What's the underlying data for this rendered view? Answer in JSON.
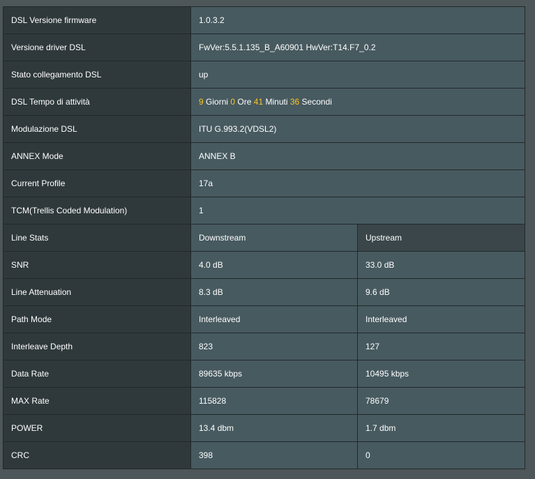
{
  "info_rows": [
    {
      "label": "DSL Versione firmware",
      "value": "1.0.3.2"
    },
    {
      "label": "Versione driver DSL",
      "value": "FwVer:5.5.1.135_B_A60901 HwVer:T14.F7_0.2"
    },
    {
      "label": "Stato collegamento DSL",
      "value": "up"
    }
  ],
  "uptime": {
    "label": "DSL Tempo di attività",
    "days": "9",
    "days_unit": "Giorni",
    "hours": "0",
    "hours_unit": "Ore",
    "minutes": "41",
    "minutes_unit": "Minuti",
    "seconds": "36",
    "seconds_unit": "Secondi"
  },
  "info_rows2": [
    {
      "label": "Modulazione DSL",
      "value": "ITU G.993.2(VDSL2)"
    },
    {
      "label": "ANNEX Mode",
      "value": "ANNEX B"
    },
    {
      "label": "Current Profile",
      "value": "17a"
    },
    {
      "label": "TCM(Trellis Coded Modulation)",
      "value": "1"
    }
  ],
  "line_stats": {
    "header": {
      "label": "Line Stats",
      "down": "Downstream",
      "up": "Upstream"
    },
    "rows": [
      {
        "label": "SNR",
        "down": "4.0 dB",
        "up": "33.0 dB"
      },
      {
        "label": "Line Attenuation",
        "down": "8.3 dB",
        "up": "9.6 dB"
      },
      {
        "label": "Path Mode",
        "down": "Interleaved",
        "up": "Interleaved"
      },
      {
        "label": "Interleave Depth",
        "down": "823",
        "up": "127"
      },
      {
        "label": "Data Rate",
        "down": "89635 kbps",
        "up": "10495 kbps"
      },
      {
        "label": "MAX Rate",
        "down": "115828",
        "up": "78679"
      },
      {
        "label": "POWER",
        "down": "13.4 dbm",
        "up": "1.7 dbm"
      },
      {
        "label": "CRC",
        "down": "398",
        "up": "0"
      }
    ]
  },
  "colors": {
    "highlight": "#ffc61e",
    "label_bg": "#2f393c",
    "value_bg": "#475a60"
  }
}
